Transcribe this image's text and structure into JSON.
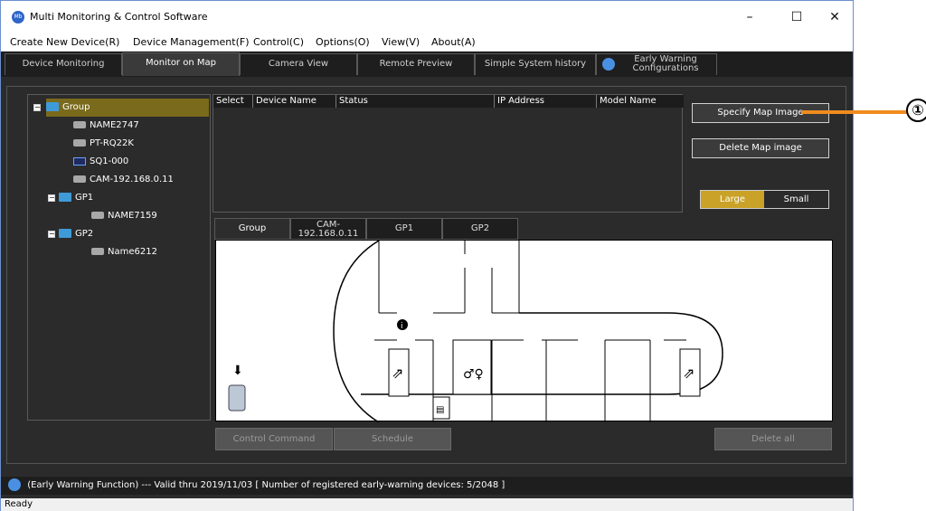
{
  "window": {
    "title": "Multi Monitoring & Control Software",
    "app_icon_text": "Mb",
    "controls": {
      "minimize": "–",
      "maximize": "☐",
      "close": "✕"
    }
  },
  "menu": [
    "Create New Device(R)",
    "Device Management(F)",
    "Control(C)",
    "Options(O)",
    "View(V)",
    "About(A)"
  ],
  "tabs": [
    {
      "label": "Device Monitoring"
    },
    {
      "label": "Monitor on Map",
      "active": true
    },
    {
      "label": "Camera View"
    },
    {
      "label": "Remote Preview"
    },
    {
      "label": "Simple System history"
    },
    {
      "label": "Early Warning Configurations"
    }
  ],
  "tree": [
    {
      "label": "Group",
      "icon": "folder-icon",
      "selected": true
    },
    {
      "label": "NAME2747",
      "icon": "camera-icon"
    },
    {
      "label": "PT-RQ22K",
      "icon": "projector-icon"
    },
    {
      "label": "SQ1-000",
      "icon": "display-icon"
    },
    {
      "label": "CAM-192.168.0.11",
      "icon": "camera-icon"
    },
    {
      "label": "GP1",
      "icon": "folder-icon"
    },
    {
      "label": "NAME7159",
      "icon": "projector-icon"
    },
    {
      "label": "GP2",
      "icon": "folder-icon"
    },
    {
      "label": "Name6212",
      "icon": "projector-icon"
    }
  ],
  "table": {
    "columns": [
      "Select",
      "Device Name",
      "Status",
      "IP Address",
      "Model Name"
    ]
  },
  "buttons": {
    "specify_map": "Specify Map Image",
    "delete_map": "Delete Map image",
    "control_command": "Control Command",
    "schedule": "Schedule",
    "delete_all": "Delete all"
  },
  "size_toggle": {
    "large": "Large",
    "small": "Small",
    "selected": "Large"
  },
  "map_tabs": [
    "Group",
    "CAM-\n192.168.0.11",
    "GP1",
    "GP2"
  ],
  "early_warning_status": "(Early Warning Function) --- Valid thru 2019/11/03  [ Number of registered early-warning devices: 5/2048 ]",
  "status": "Ready",
  "callout": "①",
  "colors": {
    "accent_orange": "#f08c1e",
    "selection": "#7a6a1c",
    "dark_bg": "#2b2b2b"
  }
}
